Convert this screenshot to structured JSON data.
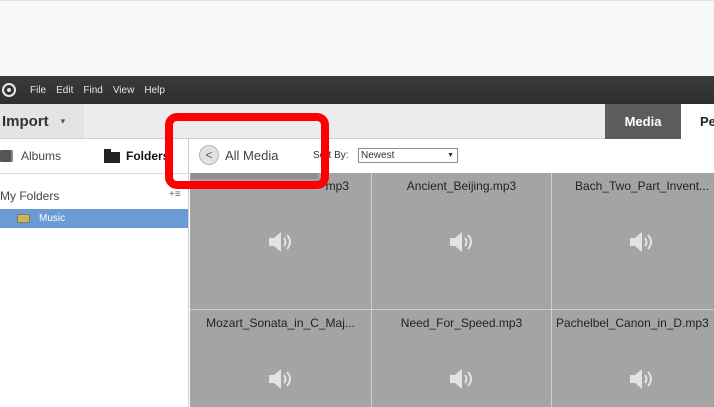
{
  "menubar": {
    "items": [
      "File",
      "Edit",
      "Find",
      "View",
      "Help"
    ]
  },
  "toolbar": {
    "import_label": "Import",
    "import_caret": "▾",
    "tab_media": "Media",
    "tab_people": "Pe"
  },
  "sidebar": {
    "albums_label": "Albums",
    "folders_label": "Folders",
    "my_folders": "My Folders",
    "my_folders_menu": "+≡",
    "music": "Music"
  },
  "content_bar": {
    "back": "<",
    "title": "All Media",
    "sort_label": "Sort By:",
    "sort_value": "Newest",
    "sort_arrow": "▼"
  },
  "tiles": [
    "mp3",
    "Ancient_Beijing.mp3",
    "Bach_Two_Part_Invent...",
    "Mozart_Sonata_in_C_Maj...",
    "Need_For_Speed.mp3",
    "Pachelbel_Canon_in_D.mp3"
  ],
  "colors": {
    "highlight": "#ff0000",
    "tile": "#a4a4a4",
    "selected": "#6a9bd4",
    "active_tab": "#5c5c5c"
  }
}
